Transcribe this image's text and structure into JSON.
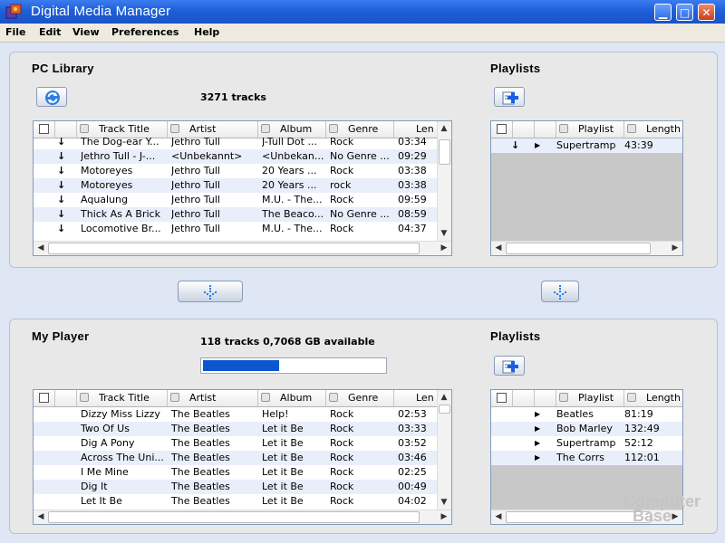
{
  "window": {
    "title": "Digital Media Manager"
  },
  "menu": [
    "File",
    "Edit",
    "View",
    "Preferences",
    "Help"
  ],
  "library": {
    "title": "PC Library",
    "status": "3271 tracks",
    "columns": [
      "Track Title",
      "Artist",
      "Album",
      "Genre",
      "Len"
    ],
    "rows": [
      [
        "The Dog-ear Y...",
        "Jethro Tull",
        "J-Tull Dot ...",
        "Rock",
        "03:34"
      ],
      [
        "Jethro Tull - J-...",
        "<Unbekannt>",
        "<Unbekan...",
        "No Genre ...",
        "09:29"
      ],
      [
        "Motoreyes",
        "Jethro Tull",
        "20 Years ...",
        "Rock",
        "03:38"
      ],
      [
        "Motoreyes",
        "Jethro Tull",
        "20 Years ...",
        "rock",
        "03:38"
      ],
      [
        "Aqualung",
        "Jethro Tull",
        "M.U. - The...",
        "Rock",
        "09:59"
      ],
      [
        "Thick As A Brick",
        "Jethro Tull",
        "The Beaco...",
        "No Genre ...",
        "08:59"
      ],
      [
        "Locomotive Br...",
        "Jethro Tull",
        "M.U. - The...",
        "Rock",
        "04:37"
      ]
    ]
  },
  "library_playlists": {
    "title": "Playlists",
    "columns": [
      "Playlist",
      "Length"
    ],
    "rows": [
      [
        "Supertramp",
        "43:39"
      ]
    ]
  },
  "player": {
    "title": "My Player",
    "status": "118 tracks  0,7068 GB available",
    "capacity_used_fraction": 0.42,
    "columns": [
      "Track Title",
      "Artist",
      "Album",
      "Genre",
      "Len"
    ],
    "rows": [
      [
        "Dizzy Miss Lizzy",
        "The Beatles",
        "Help!",
        "Rock",
        "02:53"
      ],
      [
        "Two Of Us",
        "The Beatles",
        "Let it Be",
        "Rock",
        "03:33"
      ],
      [
        "Dig A Pony",
        "The Beatles",
        "Let it Be",
        "Rock",
        "03:52"
      ],
      [
        "Across The Uni...",
        "The Beatles",
        "Let it Be",
        "Rock",
        "03:46"
      ],
      [
        "I Me Mine",
        "The Beatles",
        "Let it Be",
        "Rock",
        "02:25"
      ],
      [
        "Dig It",
        "The Beatles",
        "Let it Be",
        "Rock",
        "00:49"
      ],
      [
        "Let It Be",
        "The Beatles",
        "Let it Be",
        "Rock",
        "04:02"
      ]
    ]
  },
  "player_playlists": {
    "title": "Playlists",
    "columns": [
      "Playlist",
      "Length"
    ],
    "rows": [
      [
        "Beatles",
        "81:19"
      ],
      [
        "Bob Marley",
        "132:49"
      ],
      [
        "Supertramp",
        "52:12"
      ],
      [
        "The Corrs",
        "112:01"
      ]
    ]
  },
  "watermark": {
    "line1": "Computer",
    "line2": "Base"
  },
  "colors": {
    "titlebar": "#1f5fd8",
    "progress": "#0b55d0",
    "alt_row": "#e9eefb"
  },
  "icons": [
    "app-icon",
    "refresh-icon",
    "add-playlist-icon",
    "transfer-down-icon",
    "minimize-icon",
    "maximize-icon",
    "close-icon",
    "download-arrow-icon",
    "play-triangle-icon"
  ]
}
